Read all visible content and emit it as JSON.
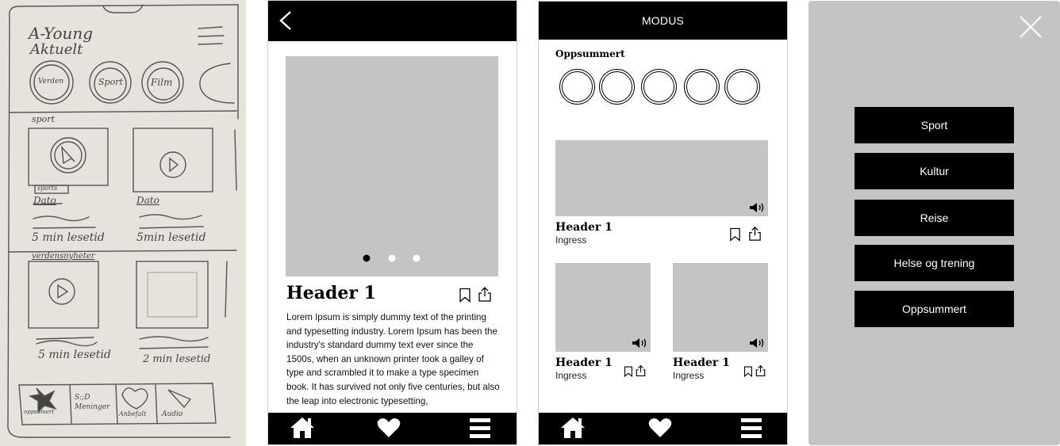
{
  "sketch": {
    "title_line1": "A-Young",
    "title_line2": "Aktuelt",
    "categories": [
      "Verden",
      "Sport",
      "Film"
    ],
    "section_sport": "sport",
    "tag_sports": "sports",
    "dato_left": "Dato",
    "dato_right": "Dato",
    "readtime_1": "5 min lesetid",
    "readtime_2": "5min lesetid",
    "section_verden": "verdensnyheter",
    "readtime_3": "5 min lesetid",
    "readtime_4": "2 min lesetid",
    "tabs": [
      "oppsumert",
      "S:;D Meninger",
      "Anbefalt",
      "Audio"
    ]
  },
  "article": {
    "title": "Header 1",
    "body": "Lorem Ipsum is simply dummy text of the printing and typesetting industry. Lorem Ipsum has been the industry's standard dummy text ever since the 1500s, when an unknown printer took a galley of type and scrambled it to make a type specimen book. It has survived not only five centuries, but also the leap into electronic typesetting,",
    "carousel_index": 1,
    "carousel_count": 3
  },
  "feed": {
    "topbar_title": "MODUS",
    "section_title": "Oppsummert",
    "story_count": 5,
    "cards": [
      {
        "title": "Header 1",
        "ingress": "Ingress"
      },
      {
        "title": "Header 1",
        "ingress": "Ingress"
      },
      {
        "title": "Header 1",
        "ingress": "Ingress"
      }
    ]
  },
  "menu": {
    "items": [
      "Sport",
      "Kultur",
      "Reise",
      "Helse og trening",
      "Oppsummert"
    ]
  },
  "colors": {
    "bar": "#000000",
    "placeholder": "#c4c4c4",
    "menu_bg": "#c4c4c4",
    "paper": "#e6e3dc"
  },
  "icons": {
    "back": "chevron-left-icon",
    "bookmark": "bookmark-icon",
    "share": "share-icon",
    "audio": "speaker-icon",
    "home": "home-icon",
    "heart": "heart-icon",
    "menu": "hamburger-icon",
    "close": "close-icon"
  }
}
